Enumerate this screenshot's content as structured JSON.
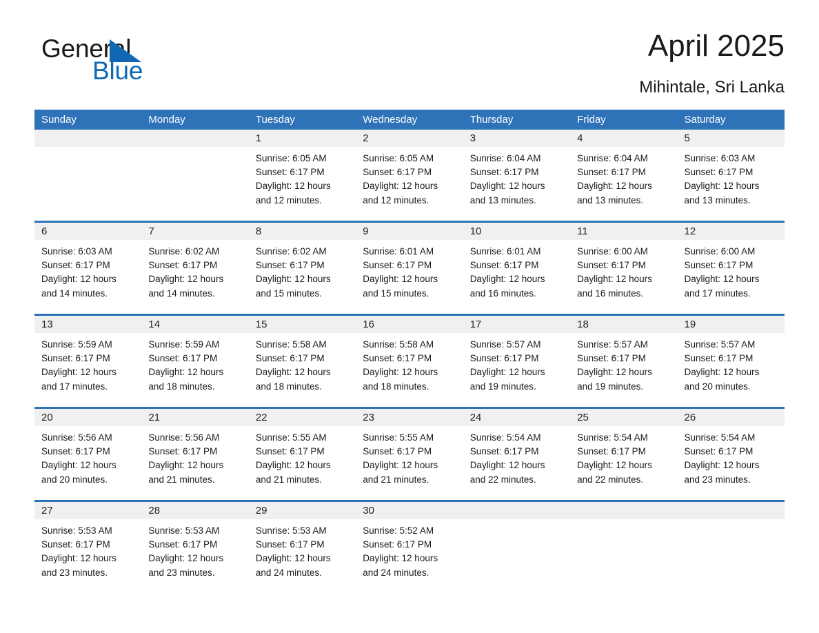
{
  "brand": {
    "word1": "General",
    "word2": "Blue",
    "mark": "triangle-logo"
  },
  "header": {
    "title": "April 2025",
    "subtitle": "Mihintale, Sri Lanka"
  },
  "colors": {
    "accent_blue": "#2E72B8",
    "brand_blue": "#1068b3",
    "daynum_band": "#F0F0F0",
    "text": "#1a1a1a",
    "header_text": "#ffffff"
  },
  "weekdays": [
    "Sunday",
    "Monday",
    "Tuesday",
    "Wednesday",
    "Thursday",
    "Friday",
    "Saturday"
  ],
  "weeks": [
    [
      {
        "day": "",
        "sunrise": "",
        "sunset": "",
        "daylight_a": "",
        "daylight_b": ""
      },
      {
        "day": "",
        "sunrise": "",
        "sunset": "",
        "daylight_a": "",
        "daylight_b": ""
      },
      {
        "day": "1",
        "sunrise": "Sunrise: 6:05 AM",
        "sunset": "Sunset: 6:17 PM",
        "daylight_a": "Daylight: 12 hours",
        "daylight_b": "and 12 minutes."
      },
      {
        "day": "2",
        "sunrise": "Sunrise: 6:05 AM",
        "sunset": "Sunset: 6:17 PM",
        "daylight_a": "Daylight: 12 hours",
        "daylight_b": "and 12 minutes."
      },
      {
        "day": "3",
        "sunrise": "Sunrise: 6:04 AM",
        "sunset": "Sunset: 6:17 PM",
        "daylight_a": "Daylight: 12 hours",
        "daylight_b": "and 13 minutes."
      },
      {
        "day": "4",
        "sunrise": "Sunrise: 6:04 AM",
        "sunset": "Sunset: 6:17 PM",
        "daylight_a": "Daylight: 12 hours",
        "daylight_b": "and 13 minutes."
      },
      {
        "day": "5",
        "sunrise": "Sunrise: 6:03 AM",
        "sunset": "Sunset: 6:17 PM",
        "daylight_a": "Daylight: 12 hours",
        "daylight_b": "and 13 minutes."
      }
    ],
    [
      {
        "day": "6",
        "sunrise": "Sunrise: 6:03 AM",
        "sunset": "Sunset: 6:17 PM",
        "daylight_a": "Daylight: 12 hours",
        "daylight_b": "and 14 minutes."
      },
      {
        "day": "7",
        "sunrise": "Sunrise: 6:02 AM",
        "sunset": "Sunset: 6:17 PM",
        "daylight_a": "Daylight: 12 hours",
        "daylight_b": "and 14 minutes."
      },
      {
        "day": "8",
        "sunrise": "Sunrise: 6:02 AM",
        "sunset": "Sunset: 6:17 PM",
        "daylight_a": "Daylight: 12 hours",
        "daylight_b": "and 15 minutes."
      },
      {
        "day": "9",
        "sunrise": "Sunrise: 6:01 AM",
        "sunset": "Sunset: 6:17 PM",
        "daylight_a": "Daylight: 12 hours",
        "daylight_b": "and 15 minutes."
      },
      {
        "day": "10",
        "sunrise": "Sunrise: 6:01 AM",
        "sunset": "Sunset: 6:17 PM",
        "daylight_a": "Daylight: 12 hours",
        "daylight_b": "and 16 minutes."
      },
      {
        "day": "11",
        "sunrise": "Sunrise: 6:00 AM",
        "sunset": "Sunset: 6:17 PM",
        "daylight_a": "Daylight: 12 hours",
        "daylight_b": "and 16 minutes."
      },
      {
        "day": "12",
        "sunrise": "Sunrise: 6:00 AM",
        "sunset": "Sunset: 6:17 PM",
        "daylight_a": "Daylight: 12 hours",
        "daylight_b": "and 17 minutes."
      }
    ],
    [
      {
        "day": "13",
        "sunrise": "Sunrise: 5:59 AM",
        "sunset": "Sunset: 6:17 PM",
        "daylight_a": "Daylight: 12 hours",
        "daylight_b": "and 17 minutes."
      },
      {
        "day": "14",
        "sunrise": "Sunrise: 5:59 AM",
        "sunset": "Sunset: 6:17 PM",
        "daylight_a": "Daylight: 12 hours",
        "daylight_b": "and 18 minutes."
      },
      {
        "day": "15",
        "sunrise": "Sunrise: 5:58 AM",
        "sunset": "Sunset: 6:17 PM",
        "daylight_a": "Daylight: 12 hours",
        "daylight_b": "and 18 minutes."
      },
      {
        "day": "16",
        "sunrise": "Sunrise: 5:58 AM",
        "sunset": "Sunset: 6:17 PM",
        "daylight_a": "Daylight: 12 hours",
        "daylight_b": "and 18 minutes."
      },
      {
        "day": "17",
        "sunrise": "Sunrise: 5:57 AM",
        "sunset": "Sunset: 6:17 PM",
        "daylight_a": "Daylight: 12 hours",
        "daylight_b": "and 19 minutes."
      },
      {
        "day": "18",
        "sunrise": "Sunrise: 5:57 AM",
        "sunset": "Sunset: 6:17 PM",
        "daylight_a": "Daylight: 12 hours",
        "daylight_b": "and 19 minutes."
      },
      {
        "day": "19",
        "sunrise": "Sunrise: 5:57 AM",
        "sunset": "Sunset: 6:17 PM",
        "daylight_a": "Daylight: 12 hours",
        "daylight_b": "and 20 minutes."
      }
    ],
    [
      {
        "day": "20",
        "sunrise": "Sunrise: 5:56 AM",
        "sunset": "Sunset: 6:17 PM",
        "daylight_a": "Daylight: 12 hours",
        "daylight_b": "and 20 minutes."
      },
      {
        "day": "21",
        "sunrise": "Sunrise: 5:56 AM",
        "sunset": "Sunset: 6:17 PM",
        "daylight_a": "Daylight: 12 hours",
        "daylight_b": "and 21 minutes."
      },
      {
        "day": "22",
        "sunrise": "Sunrise: 5:55 AM",
        "sunset": "Sunset: 6:17 PM",
        "daylight_a": "Daylight: 12 hours",
        "daylight_b": "and 21 minutes."
      },
      {
        "day": "23",
        "sunrise": "Sunrise: 5:55 AM",
        "sunset": "Sunset: 6:17 PM",
        "daylight_a": "Daylight: 12 hours",
        "daylight_b": "and 21 minutes."
      },
      {
        "day": "24",
        "sunrise": "Sunrise: 5:54 AM",
        "sunset": "Sunset: 6:17 PM",
        "daylight_a": "Daylight: 12 hours",
        "daylight_b": "and 22 minutes."
      },
      {
        "day": "25",
        "sunrise": "Sunrise: 5:54 AM",
        "sunset": "Sunset: 6:17 PM",
        "daylight_a": "Daylight: 12 hours",
        "daylight_b": "and 22 minutes."
      },
      {
        "day": "26",
        "sunrise": "Sunrise: 5:54 AM",
        "sunset": "Sunset: 6:17 PM",
        "daylight_a": "Daylight: 12 hours",
        "daylight_b": "and 23 minutes."
      }
    ],
    [
      {
        "day": "27",
        "sunrise": "Sunrise: 5:53 AM",
        "sunset": "Sunset: 6:17 PM",
        "daylight_a": "Daylight: 12 hours",
        "daylight_b": "and 23 minutes."
      },
      {
        "day": "28",
        "sunrise": "Sunrise: 5:53 AM",
        "sunset": "Sunset: 6:17 PM",
        "daylight_a": "Daylight: 12 hours",
        "daylight_b": "and 23 minutes."
      },
      {
        "day": "29",
        "sunrise": "Sunrise: 5:53 AM",
        "sunset": "Sunset: 6:17 PM",
        "daylight_a": "Daylight: 12 hours",
        "daylight_b": "and 24 minutes."
      },
      {
        "day": "30",
        "sunrise": "Sunrise: 5:52 AM",
        "sunset": "Sunset: 6:17 PM",
        "daylight_a": "Daylight: 12 hours",
        "daylight_b": "and 24 minutes."
      },
      {
        "day": "",
        "sunrise": "",
        "sunset": "",
        "daylight_a": "",
        "daylight_b": ""
      },
      {
        "day": "",
        "sunrise": "",
        "sunset": "",
        "daylight_a": "",
        "daylight_b": ""
      },
      {
        "day": "",
        "sunrise": "",
        "sunset": "",
        "daylight_a": "",
        "daylight_b": ""
      }
    ]
  ]
}
